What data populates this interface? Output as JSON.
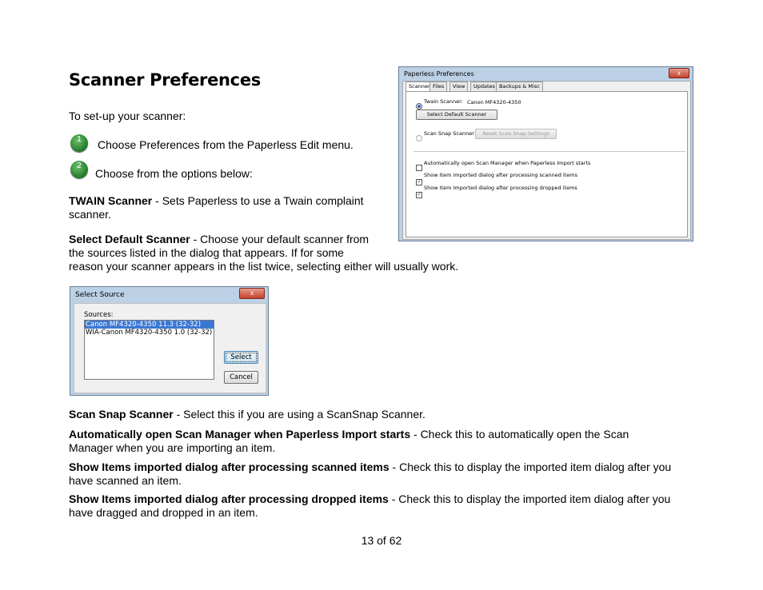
{
  "page": {
    "title": "Scanner Preferences",
    "intro": "To set-up your scanner:",
    "step1_number": "1",
    "step1": "Choose Preferences from the Paperless Edit menu.",
    "step2_number": "2",
    "step2": "Choose from the options below:",
    "twain_term": "TWAIN Scanner",
    "twain_desc_1": " - Sets Paperless to use a Twain complaint",
    "twain_desc_2": "scanner.",
    "select_term": "Select Default Scanner",
    "select_desc_1": " - Choose your default scanner from",
    "select_desc_2": "the sources listed in the dialog that appears. If for some",
    "select_desc_3": "reason your scanner appears in the list twice, selecting either will usually work.",
    "scansnap_term": "Scan Snap Scanner",
    "scansnap_desc": " - Select this if you are using a ScanSnap Scanner.",
    "auto_term": "Automatically open Scan Manager when Paperless Import starts",
    "auto_desc_1": " - Check this to automatically open the Scan",
    "auto_desc_2": "Manager when you are importing an item.",
    "scanned_term": "Show Items imported dialog after processing scanned items",
    "scanned_desc_1": " - Check this to display the imported item dialog after you",
    "scanned_desc_2": "have scanned an item.",
    "dropped_term": "Show Items imported dialog after processing dropped items",
    "dropped_desc_1": " - Check this to display the imported item dialog after you",
    "dropped_desc_2": "have dragged and dropped in an item.",
    "footer": "13 of 62"
  },
  "prefs_window": {
    "title": "Paperless Preferences",
    "close": "x",
    "tabs": [
      "Scanner",
      "Files",
      "View",
      "Updates",
      "Backups & Misc"
    ],
    "twain_label": "Twain Scanner:",
    "twain_value": "Canon MF4320-4350",
    "select_default_button": "Select Default Scanner",
    "scansnap_label": "Scan Snap Scanner",
    "reset_button": "Reset Scan Snap Settings",
    "check_auto": "Automatically open Scan Manager when Paperless Import starts",
    "check_scanned": "Show Item imported dialog after processing scanned items",
    "check_dropped": "Show Item Imported dialog after processing dropped items",
    "check_mark": "✓"
  },
  "source_dialog": {
    "title": "Select Source",
    "close": "x",
    "sources_label": "Sources:",
    "sources": [
      "Canon MF4320-4350 11.3 (32-32)",
      "WIA-Canon MF4320-4350 1.0 (32-32)"
    ],
    "select_button": "Select",
    "cancel_button": "Cancel"
  }
}
